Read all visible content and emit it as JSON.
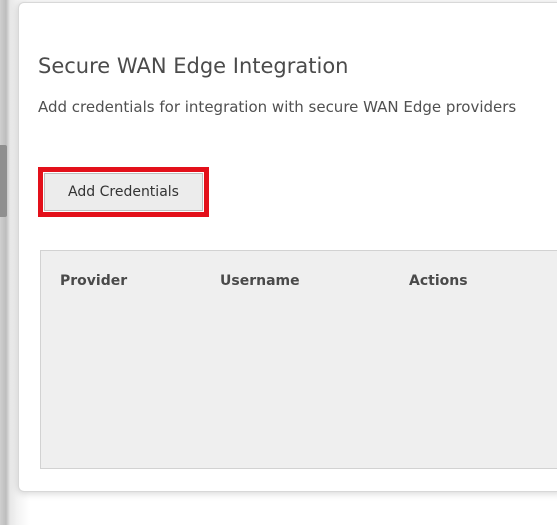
{
  "card": {
    "title": "Secure WAN Edge Integration",
    "description": "Add credentials for integration with secure WAN Edge providers",
    "add_button_label": "Add Credentials"
  },
  "table": {
    "columns": [
      "Provider",
      "Username",
      "Actions"
    ],
    "rows": []
  },
  "colors": {
    "highlight": "#e3101a",
    "button_bg": "#ececec",
    "table_bg": "#efefef"
  }
}
